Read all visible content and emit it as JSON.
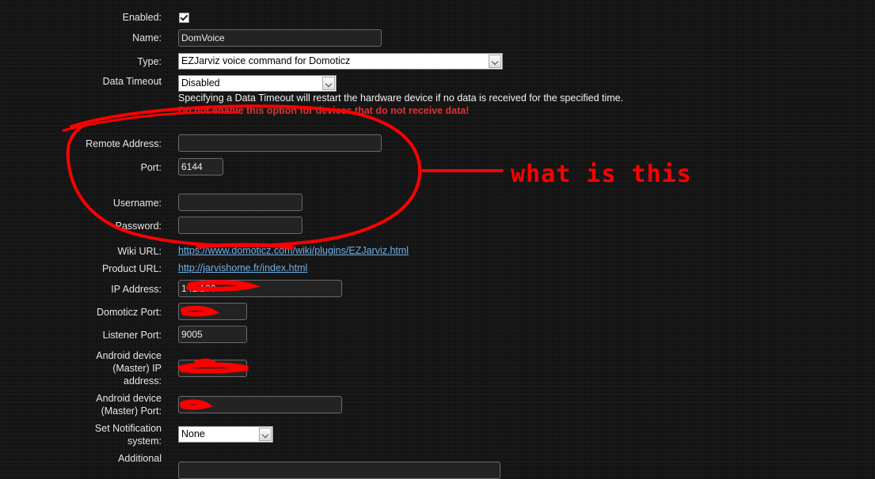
{
  "form": {
    "enabled_label": "Enabled:",
    "name_label": "Name:",
    "name_value": "DomVoice",
    "type_label": "Type:",
    "type_value": "EZJarviz voice command for Domoticz",
    "timeout_label": "Data Timeout",
    "timeout_value": "Disabled",
    "timeout_info": "Specifying a Data Timeout will restart the hardware device if no data is received for the specified time.",
    "timeout_warning": "Do not enable this option for devices that do not receive data!",
    "remote_address_label": "Remote Address:",
    "remote_address_value": "",
    "port_label": "Port:",
    "port_value": "6144",
    "username_label": "Username:",
    "username_value": "",
    "password_label": "Password:",
    "password_value": "",
    "wiki_label": "Wiki URL:",
    "wiki_url": "https://www.domoticz.com/wiki/plugins/EZJarviz.html",
    "product_label": "Product URL:",
    "product_url": "http://jarvishome.fr/index.html",
    "ip_label": "IP Address:",
    "ip_value": "1      .1.100",
    "domoticz_port_label": "Domoticz Port:",
    "domoticz_port_value": "",
    "listener_port_label": "Listener Port:",
    "listener_port_value": "9005",
    "android_ip_label_1": "Android device",
    "android_ip_label_2": "(Master) IP",
    "android_ip_label_3": "address:",
    "android_ip_value": "",
    "android_port_label_1": "Android device",
    "android_port_label_2": "(Master) Port:",
    "android_port_value": "",
    "notification_label_1": "Set Notification",
    "notification_label_2": "system:",
    "notification_value": "None",
    "additional_label": "Additional"
  },
  "annotation": {
    "text": "what is this",
    "color": "#ff0000"
  }
}
